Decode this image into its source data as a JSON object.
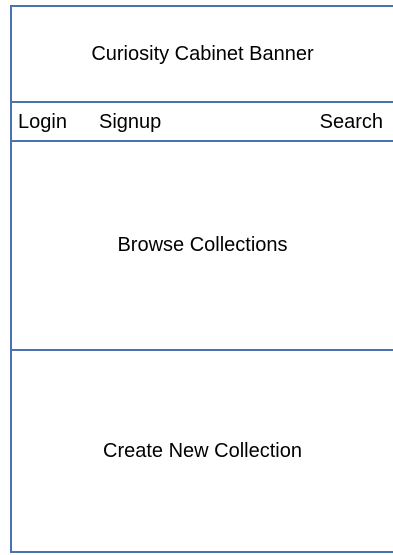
{
  "banner": {
    "title": "Curiosity Cabinet Banner"
  },
  "nav": {
    "login": "Login",
    "signup": "Signup",
    "search": "Search"
  },
  "sections": {
    "browse": "Browse Collections",
    "create": "Create New Collection"
  },
  "colors": {
    "border": "#4a72b0",
    "background": "#ffffff",
    "text": "#000000"
  }
}
